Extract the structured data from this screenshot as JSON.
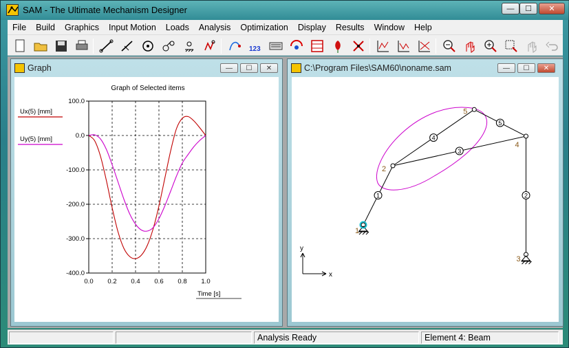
{
  "app": {
    "title": "SAM - The Ultimate Mechanism Designer",
    "caption_buttons": {
      "minimize": "—",
      "maximize": "☐",
      "close": "✕"
    }
  },
  "menu": [
    "File",
    "Build",
    "Graphics",
    "Input Motion",
    "Loads",
    "Analysis",
    "Optimization",
    "Display",
    "Results",
    "Window",
    "Help"
  ],
  "toolbar": {
    "buttons": [
      "new-file-icon",
      "open-folder-icon",
      "save-icon",
      "print-icon",
      "beam-element-icon",
      "slider-element-icon",
      "gear-element-icon",
      "belt-element-icon",
      "fixed-support-icon",
      "spring-element-icon",
      "path-tracer-icon",
      "numbering-icon",
      "keyboard-input-icon",
      "motion-icon",
      "animation-frame-icon",
      "rose-icon",
      "windmill-icon",
      "graph-1-icon",
      "graph-2-icon",
      "graph-3-icon",
      "zoom-out-icon",
      "pan-hand-icon",
      "zoom-in-icon",
      "zoom-window-icon",
      "hand-disabled-icon",
      "undo-icon"
    ]
  },
  "graph_window": {
    "title": "Graph",
    "caption_buttons": {
      "minimize": "—",
      "maximize": "☐",
      "close": "✕"
    },
    "legend": [
      {
        "label": "Ux(5) [mm]",
        "color": "#c00000"
      },
      {
        "label": "Uy(5) [mm]",
        "color": "#cc00cc"
      }
    ]
  },
  "chart_data": {
    "type": "line",
    "title": "Graph of Selected items",
    "xlabel": "Time [s]",
    "ylabel": "",
    "xlim": [
      0.0,
      1.0
    ],
    "ylim": [
      -400.0,
      100.0
    ],
    "x_ticks": [
      "0.0",
      "0.2",
      "0.4",
      "0.6",
      "0.8",
      "1.0"
    ],
    "y_ticks": [
      "100.0",
      "0.0",
      "-100.0",
      "-200.0",
      "-300.0",
      "-400.0"
    ],
    "grid": true,
    "series": [
      {
        "name": "Ux(5) [mm]",
        "color": "#c00000",
        "x": [
          0.0,
          0.05,
          0.1,
          0.15,
          0.2,
          0.25,
          0.3,
          0.35,
          0.4,
          0.45,
          0.5,
          0.55,
          0.6,
          0.65,
          0.7,
          0.75,
          0.8,
          0.85,
          0.9,
          0.95,
          1.0
        ],
        "y": [
          0,
          -15,
          -60,
          -130,
          -210,
          -280,
          -328,
          -352,
          -358,
          -348,
          -320,
          -272,
          -205,
          -125,
          -45,
          20,
          50,
          55,
          42,
          22,
          0
        ]
      },
      {
        "name": "Uy(5) [mm]",
        "color": "#cc00cc",
        "x": [
          0.0,
          0.05,
          0.1,
          0.15,
          0.2,
          0.25,
          0.3,
          0.35,
          0.4,
          0.45,
          0.5,
          0.55,
          0.6,
          0.65,
          0.7,
          0.75,
          0.8,
          0.85,
          0.9,
          0.95,
          1.0
        ],
        "y": [
          0,
          2,
          -10,
          -40,
          -85,
          -135,
          -185,
          -228,
          -258,
          -275,
          -278,
          -268,
          -242,
          -205,
          -162,
          -118,
          -80,
          -55,
          -32,
          -14,
          0
        ]
      }
    ]
  },
  "mechanism_window": {
    "title": "C:\\Program Files\\SAM60\\noname.sam",
    "caption_buttons": {
      "minimize": "—",
      "maximize": "☐",
      "close": "✕"
    },
    "nodes": [
      {
        "label": "1",
        "x": 0.0,
        "y": 0.0
      },
      {
        "label": "2",
        "x": 1.0,
        "y": 2.0
      },
      {
        "label": "3",
        "x": 5.5,
        "y": -1.0
      },
      {
        "label": "4",
        "x": 5.5,
        "y": 3.0
      },
      {
        "label": "5",
        "x": 3.75,
        "y": 3.9
      }
    ],
    "elements": [
      "1",
      "2",
      "3",
      "4",
      "5"
    ],
    "axis_x_label": "x",
    "axis_y_label": "y",
    "path_color": "#cc00cc"
  },
  "status": {
    "panel1": "",
    "panel2": "",
    "panel3": "Analysis Ready",
    "panel4": "Element 4: Beam"
  }
}
